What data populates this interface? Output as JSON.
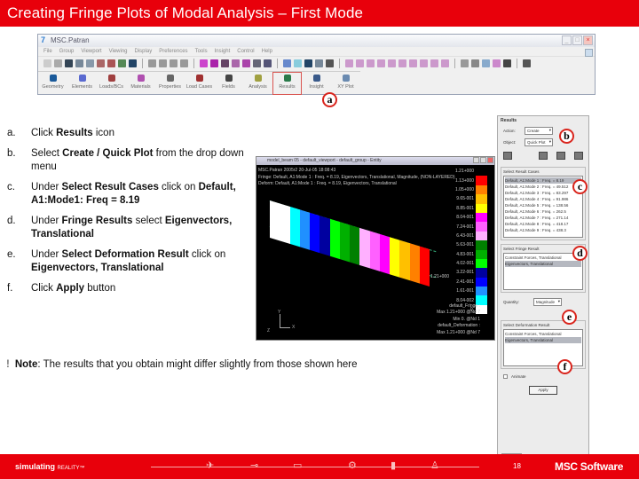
{
  "slide": {
    "title": "Creating Fringe Plots of Modal Analysis – First Mode",
    "page_number": "18",
    "footer_brand": "simulating",
    "footer_brand_suffix": "REALITY™",
    "footer_logo": "MSC Software"
  },
  "patran": {
    "window_title": "MSC.Patran",
    "menu": [
      "File",
      "Group",
      "Viewport",
      "Viewing",
      "Display",
      "Preferences",
      "Tools",
      "Insight",
      "Control",
      "Help"
    ],
    "apps": [
      {
        "label": "Geometry",
        "color": "#1a5a9a"
      },
      {
        "label": "Elements",
        "color": "#5a6ad0"
      },
      {
        "label": "Loads/BCs",
        "color": "#a04040"
      },
      {
        "label": "Materials",
        "color": "#b050b0"
      },
      {
        "label": "Properties",
        "color": "#666666"
      },
      {
        "label": "Load Cases",
        "color": "#a03030"
      },
      {
        "label": "Fields",
        "color": "#444444"
      },
      {
        "label": "Analysis",
        "color": "#a0a040"
      },
      {
        "label": "Results",
        "color": "#2a7a4a",
        "active": true
      },
      {
        "label": "Insight",
        "color": "#3a5a8a"
      },
      {
        "label": "XY Plot",
        "color": "#6a8ab0"
      }
    ]
  },
  "callouts": {
    "a": "a",
    "b": "b",
    "c": "c",
    "d": "d",
    "e": "e",
    "f": "f"
  },
  "steps": [
    {
      "label": "a.",
      "parts": [
        {
          "t": "Click "
        },
        {
          "b": "Results"
        },
        {
          "t": " icon"
        }
      ]
    },
    {
      "label": "b.",
      "parts": [
        {
          "t": "Select "
        },
        {
          "b": "Create / Quick Plot"
        },
        {
          "t": " from the drop down menu"
        }
      ]
    },
    {
      "label": "c.",
      "parts": [
        {
          "t": "Under "
        },
        {
          "b": "Select Result Cases"
        },
        {
          "t": " click on "
        },
        {
          "b": "Default, A1:Mode1: Freq = 8.19"
        }
      ]
    },
    {
      "label": "d.",
      "parts": [
        {
          "t": "Under "
        },
        {
          "b": "Fringe Results"
        },
        {
          "t": " select "
        },
        {
          "b": "Eigenvectors, Translational"
        }
      ]
    },
    {
      "label": "e.",
      "parts": [
        {
          "t": "Under "
        },
        {
          "b": "Select Deformation Result"
        },
        {
          "t": " click on "
        },
        {
          "b": "Eigenvectors, Translational"
        }
      ]
    },
    {
      "label": "f.",
      "parts": [
        {
          "t": "Click "
        },
        {
          "b": "Apply"
        },
        {
          "t": " button"
        }
      ]
    }
  ],
  "viewport": {
    "title": "model_beam 05 - default_viewport - default_group - Entity",
    "line1": "MSC.Patran 2005r2 20-Jul-05 18:08:43",
    "line2": "Fringe: Default, A1:Mode 1 : Freq. = 8.19, Eigenvectors, Translational, Magnitude, (NON-LAYERED)",
    "line3": "Deform: Default, A1:Mode 1 : Freq. = 8.19, Eigenvectors, Translational",
    "legend": [
      {
        "value": "1.21+000",
        "color": "#000000"
      },
      {
        "value": "1.13+000",
        "color": "#ff0000"
      },
      {
        "value": "1.05+000",
        "color": "#ff8000"
      },
      {
        "value": "9.65-001",
        "color": "#ffc000"
      },
      {
        "value": "8.85-001",
        "color": "#ffff00"
      },
      {
        "value": "8.04-001",
        "color": "#ff00ff"
      },
      {
        "value": "7.24-001",
        "color": "#ff60ff"
      },
      {
        "value": "6.43-001",
        "color": "#ffb0ff"
      },
      {
        "value": "5.63-001",
        "color": "#008000"
      },
      {
        "value": "4.83-001",
        "color": "#00b000"
      },
      {
        "value": "4.02-001",
        "color": "#00ff00"
      },
      {
        "value": "3.22-001",
        "color": "#0000a0"
      },
      {
        "value": "2.41-001",
        "color": "#0000ff"
      },
      {
        "value": "1.61-001",
        "color": "#2090ff"
      },
      {
        "value": "8.04-002",
        "color": "#00ffff"
      },
      {
        "value": "0.",
        "color": "#ffffff"
      }
    ],
    "beam_colors": [
      "#ffffff",
      "#ffffff",
      "#00ffff",
      "#2090ff",
      "#0000ff",
      "#0000a0",
      "#00ff00",
      "#00b000",
      "#008000",
      "#ffb0ff",
      "#ff60ff",
      "#ff00ff",
      "#ffff00",
      "#ffc000",
      "#ff8000",
      "#ff0000"
    ],
    "node_label": "1.21+000",
    "footer": [
      "default_Fringe :",
      "Max 1.21+000 @Nd 7",
      "Min 0. @Nd 1",
      "default_Deformation :",
      "Max 1.21+000 @Nd 7"
    ],
    "axes": {
      "x": "X",
      "y": "Y",
      "z": "Z"
    }
  },
  "results_form": {
    "title": "Results",
    "action_label": "Action:",
    "action_value": "Create",
    "object_label": "Object:",
    "object_value": "Quick Plot",
    "result_cases_title": "Select Result Cases",
    "result_cases": [
      "Default, A1:Mode 1 : Freq. = 8.19",
      "Default, A1:Mode 2 : Freq. = 49.512",
      "Default, A1:Mode 3 : Freq. = 83.297",
      "Default, A1:Mode 4 : Freq. = 91.986",
      "Default, A1:Mode 5 : Freq. = 138.56",
      "Default, A1:Mode 6 : Freq. = 262.5",
      "Default, A1:Mode 7 : Freq. = 271.14",
      "Default, A1:Mode 8 : Freq. = 418.17",
      "Default, A1:Mode 9 : Freq. = 438.3"
    ],
    "fringe_title": "Select Fringe Result",
    "fringe_results": [
      "Constraint Forces, Translational",
      "Eigenvectors, Translational"
    ],
    "quantity_label": "Quantity:",
    "quantity_value": "Magnitude",
    "deform_title": "Select Deformation Result",
    "deform_results": [
      "Constraint Forces, Translational",
      "Eigenvectors, Translational"
    ],
    "animate_label": "Animate",
    "apply_label": "Apply",
    "tab_label": "Results"
  },
  "note": {
    "bold": "Note",
    "text": ": The results that you obtain might differ slightly from those shown here"
  }
}
